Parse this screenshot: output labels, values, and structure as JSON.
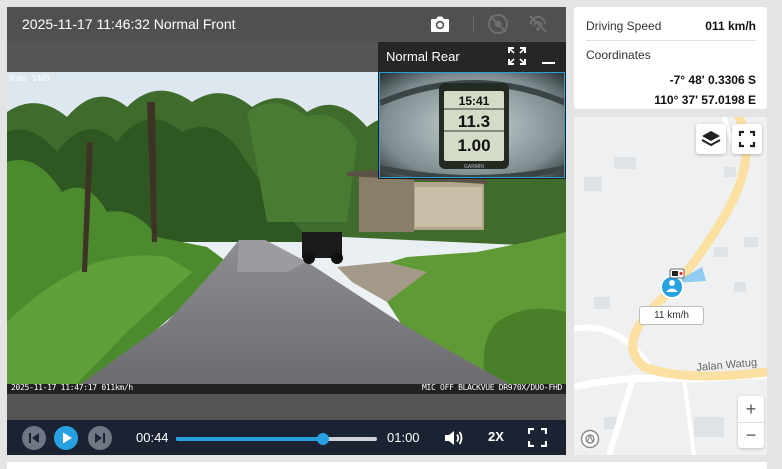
{
  "video": {
    "title": "2025-11-17 11:46:32 Normal Front",
    "overlay_top": "Ruas 1403",
    "overlay_bottom_left": "2025-11-17 11:47:17 011km/h",
    "overlay_bottom_right": "MIC OFF BLACKVUE DR970X/DUO-FHD"
  },
  "pip": {
    "title": "Normal Rear",
    "device_time": "15:41",
    "device_value_1": "11.3",
    "device_value_2": "1.00",
    "device_brand": "GARMIN"
  },
  "controls": {
    "current_time": "00:44",
    "duration": "01:00",
    "progress_fraction": 0.733,
    "speed": "2X"
  },
  "info": {
    "driving_speed_label": "Driving Speed",
    "driving_speed_value": "011 km/h",
    "coordinates_label": "Coordinates",
    "latitude": "-7° 48' 0.3306 S",
    "longitude": "110° 37' 57.0198 E"
  },
  "map": {
    "street_name": "Jalan Watug",
    "vehicle_speed": "11 km/h",
    "zoom_in_label": "+",
    "zoom_out_label": "−"
  },
  "colors": {
    "accent": "#27a0e2",
    "road": "#fce0a2",
    "control_bar": "#1b2332"
  }
}
